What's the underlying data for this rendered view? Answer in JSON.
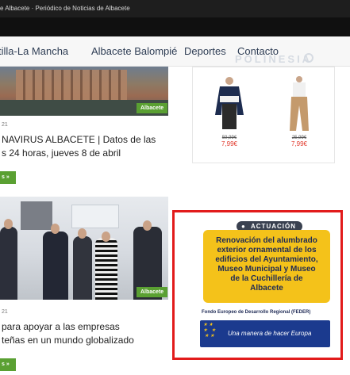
{
  "topbar": {
    "site_title": "e Albacete · Periódico de Noticias de Albacete"
  },
  "nav": {
    "items": [
      "tilla-La Mancha",
      "Albacete Balompié",
      "Deportes",
      "Contacto"
    ],
    "watermark": "POLINESIA"
  },
  "article1": {
    "badge": "Albacete",
    "date": "21",
    "headline_line1": "NAVIRUS ALBACETE | Datos de las",
    "headline_line2": "s 24 horas, jueves 8 de abril",
    "more_label": "s »"
  },
  "shop": {
    "products": [
      {
        "name": "jacket",
        "old_price": "59,99€",
        "new_price": "7,99€"
      },
      {
        "name": "cargo-pants",
        "old_price": "25,99€",
        "new_price": "7,99€"
      }
    ]
  },
  "article2": {
    "badge": "Albacete",
    "date": "21",
    "headline_line1": "para apoyar a las empresas",
    "headline_line2": "teñas en un mundo globalizado",
    "more_label": "s »"
  },
  "ad": {
    "tag": "ACTUACIÓN",
    "tag_icon": "lightbulb-icon",
    "title_lines": [
      "Renovación del alumbrado",
      "exterior ornamental de los",
      "edificios del Ayuntamiento,",
      "Museo Municipal y Museo",
      "de la Cuchillería de",
      "Albacete"
    ],
    "fund": "Fondo Europeo de Desarrollo Regional (FEDER)",
    "motto": "Una manera de hacer Europa",
    "highlight_color": "#e21b1b"
  }
}
